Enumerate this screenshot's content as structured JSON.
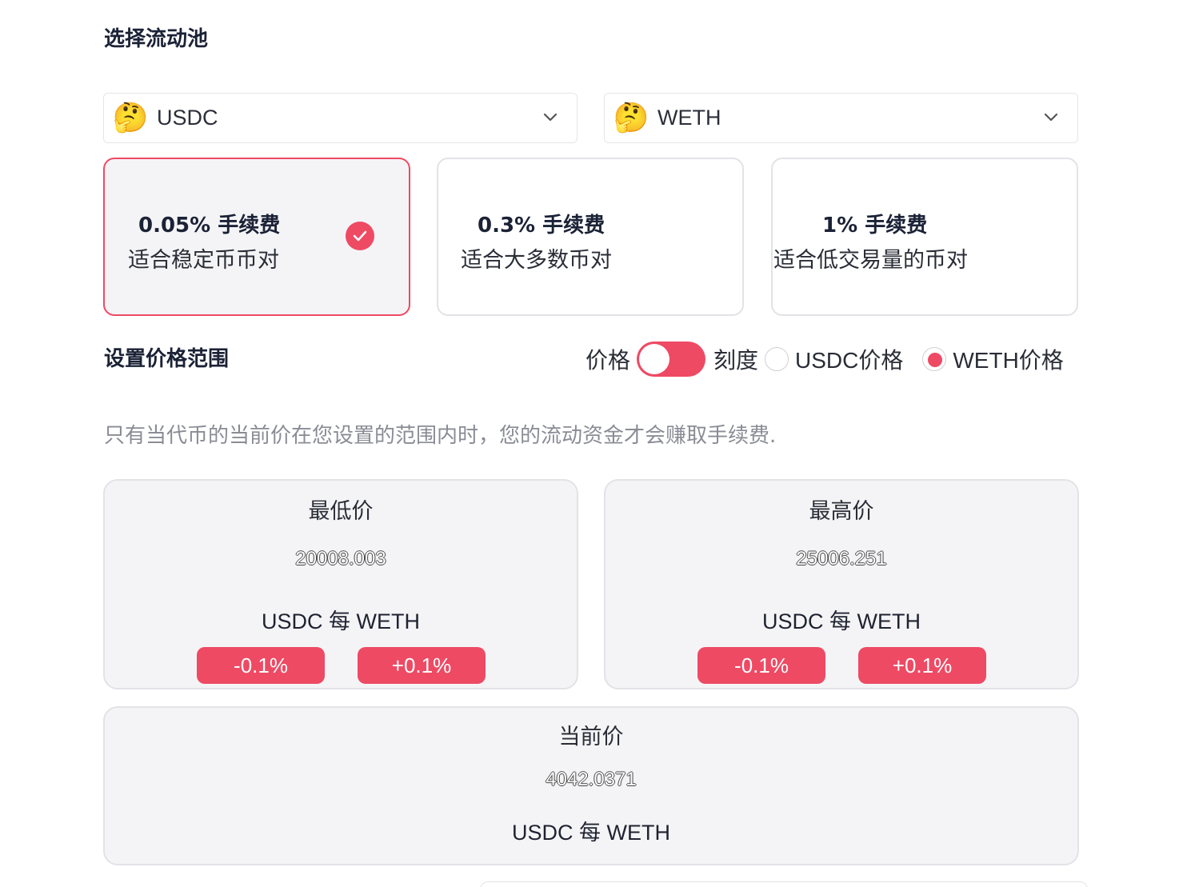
{
  "pool": {
    "section_title": "选择流动池",
    "token_a": {
      "name": "USDC",
      "icon": "thinking-face-emoji"
    },
    "token_b": {
      "name": "WETH",
      "icon": "thinking-face-emoji"
    }
  },
  "fee_tiers": [
    {
      "title": "0.05% 手续费",
      "desc": "适合稳定币币对",
      "selected": true
    },
    {
      "title": "0.3% 手续费",
      "desc": "适合大多数币对",
      "selected": false
    },
    {
      "title": "1% 手续费",
      "desc": "适合低交易量的币对",
      "selected": false
    }
  ],
  "range": {
    "section_title": "设置价格范围",
    "toggle_left_label": "价格",
    "toggle_right_label": "刻度",
    "radio_usdc_label": "USDC价格",
    "radio_weth_label": "WETH价格",
    "selected_radio": "WETH价格",
    "note": "只有当代币的当前价在您设置的范围内时，您的流动资金才会赚取手续费."
  },
  "min_price": {
    "label": "最低价",
    "value": "20008.003",
    "unit": "USDC 每 WETH",
    "minus_label": "-0.1%",
    "plus_label": "+0.1%"
  },
  "max_price": {
    "label": "最高价",
    "value": "25006.251",
    "unit": "USDC 每 WETH",
    "minus_label": "-0.1%",
    "plus_label": "+0.1%"
  },
  "current_price": {
    "label": "当前价",
    "value": "4042.0371",
    "unit": "USDC 每 WETH"
  },
  "colors": {
    "accent": "#ee4a64",
    "card_bg": "#f4f4f6",
    "border": "#e3e3e7",
    "muted_text": "#8a8c95"
  }
}
